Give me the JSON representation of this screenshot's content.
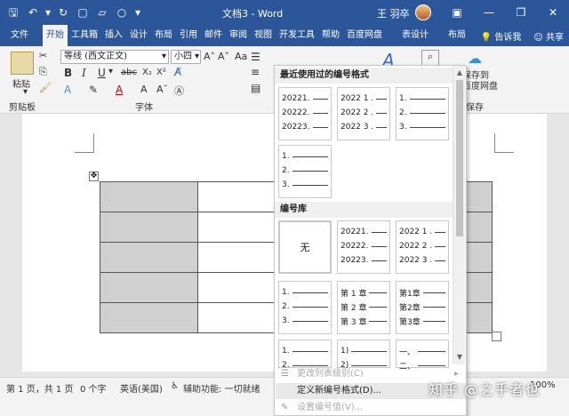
{
  "window": {
    "title": "文档3  -  Word",
    "user": "王 羽卒",
    "colors": {
      "brand": "#2b579a",
      "ribbon": "#f3f3f3"
    }
  },
  "tabs": [
    "文件",
    "开始",
    "工具箱",
    "插入",
    "设计",
    "布局",
    "引用",
    "邮件",
    "审阅",
    "视图",
    "开发工具",
    "帮助",
    "百度网盘",
    "表设计",
    "布局"
  ],
  "tabs_right": {
    "tell_me": "告诉我",
    "share": "共享"
  },
  "ribbon": {
    "paste": "粘贴",
    "clipboard_label": "剪贴板",
    "font_label": "字体",
    "font_name": "等线 (西文正文)",
    "font_size": "小四",
    "save_label": "保存",
    "save_to_baidu": [
      "保存到",
      "百度网盘"
    ]
  },
  "dropdown": {
    "recent_header": "最近使用过的编号格式",
    "library_header": "编号库",
    "recent_tiles": [
      {
        "lines": [
          "20221.",
          "20222.",
          "20223."
        ]
      },
      {
        "lines": [
          "2022 1 .",
          "2022 2 .",
          "2022 3 ."
        ]
      },
      {
        "lines": [
          "1.",
          "2.",
          "3."
        ]
      },
      {
        "lines": [
          "1.",
          "2.",
          "3."
        ]
      }
    ],
    "library_tiles": [
      {
        "none": "无"
      },
      {
        "lines": [
          "20221.",
          "20222.",
          "20223."
        ]
      },
      {
        "lines": [
          "2022 1 .",
          "2022 2 .",
          "2022 3 ."
        ]
      },
      {
        "lines": [
          "1.",
          "2.",
          "3."
        ]
      },
      {
        "lines": [
          "第 1 章",
          "第 2 章",
          "第 3 章"
        ]
      },
      {
        "lines": [
          "第1章",
          "第2章",
          "第3章"
        ]
      },
      {
        "lines": [
          "1.",
          "2."
        ]
      },
      {
        "lines": [
          "1)",
          "2)"
        ]
      },
      {
        "lines": [
          "一、",
          "二、"
        ]
      }
    ],
    "menu": [
      {
        "label": "更改列表级别(C)",
        "disabled": true
      },
      {
        "label": "定义新编号格式(D)...",
        "disabled": false
      },
      {
        "label": "设置编号值(V)...",
        "disabled": true
      }
    ]
  },
  "status": {
    "page": "第 1 页，共 1 页",
    "words": "0 个字",
    "language": "英语(美国)",
    "accessibility": "辅助功能: 一切就绪",
    "zoom": "100%"
  },
  "watermark": "知乎 @之乎者也"
}
